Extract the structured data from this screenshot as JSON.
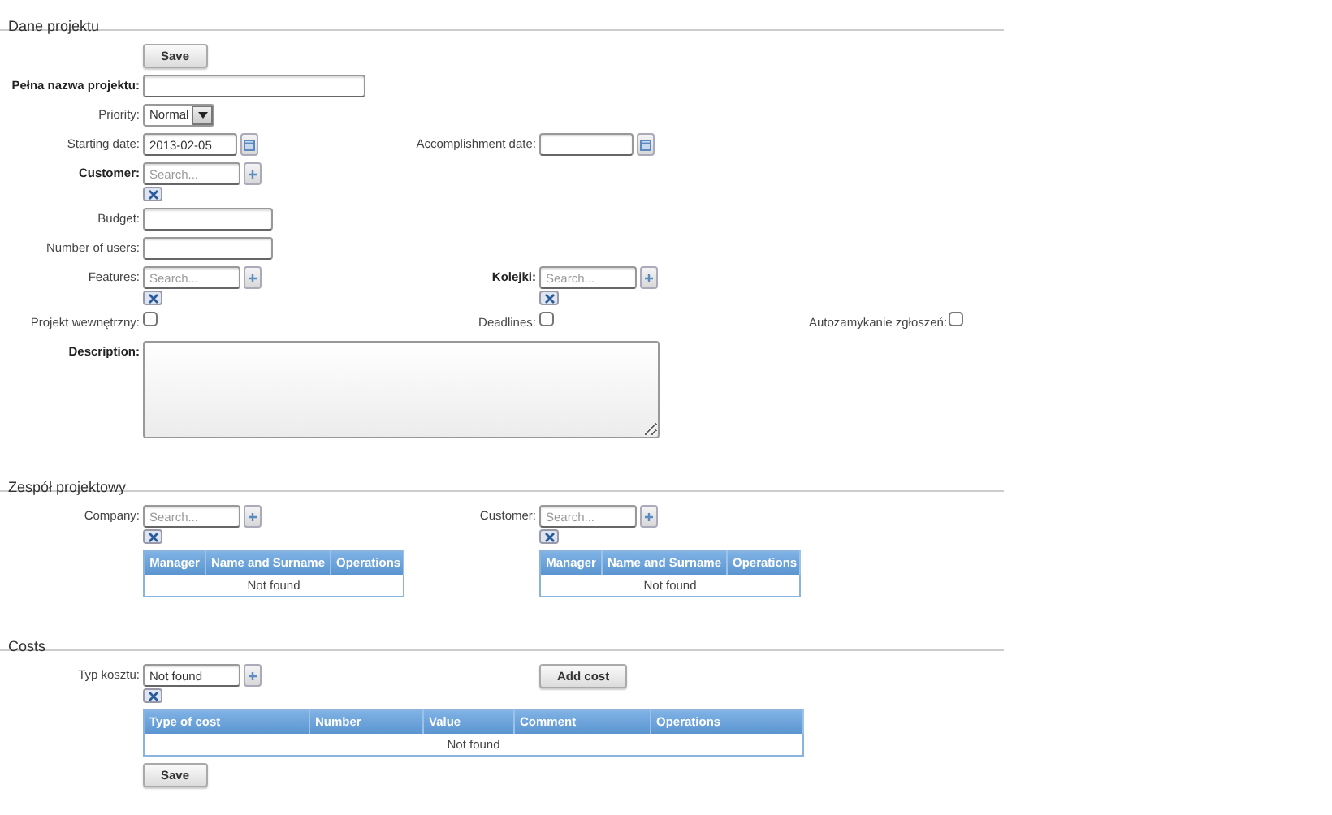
{
  "sections": [
    {
      "title": "Dane projektu",
      "rows": [
        {
          "left": {
            "kind": "button",
            "label": "Save"
          }
        },
        {
          "left": {
            "kind": "wide-text",
            "label": "Pełna nazwa projektu:",
            "bold": true
          }
        },
        {
          "left": {
            "kind": "select",
            "label": "Priority:",
            "bold": false,
            "value": "Normal"
          }
        },
        {
          "left": {
            "kind": "date",
            "label": "Starting date:",
            "bold": false,
            "value": "2013-02-05"
          },
          "middle": {
            "kind": "date",
            "label": "Accomplishment date:",
            "bold": false
          }
        },
        {
          "left": {
            "kind": "search",
            "label": "Customer:",
            "bold": true,
            "placeholder": "Search..."
          }
        },
        {
          "left": {
            "kind": "text",
            "label": "Budget:",
            "bold": false
          }
        },
        {
          "left": {
            "kind": "text",
            "label": "Number of users:",
            "bold": false
          }
        },
        {
          "left": {
            "kind": "search",
            "label": "Features:",
            "bold": false,
            "placeholder": "Search..."
          },
          "middle": {
            "kind": "search",
            "label": "Kolejki:",
            "bold": true,
            "placeholder": "Search..."
          }
        },
        {
          "left": {
            "kind": "checkbox",
            "label": "Projekt wewnętrzny:",
            "bold": false,
            "checked": false
          },
          "middle": {
            "kind": "checkbox",
            "label": "Deadlines:",
            "bold": false,
            "checked": false
          },
          "right": {
            "kind": "checkbox",
            "label": "Autozamykanie zgłoszeń:",
            "bold": false,
            "checked": false
          }
        },
        {
          "left": {
            "kind": "textarea",
            "label": "Description:",
            "bold": true
          }
        }
      ]
    },
    {
      "title": "Zespół projektowy",
      "rows": [
        {
          "left": {
            "kind": "search",
            "label": "Company:",
            "bold": false,
            "placeholder": "Search..."
          },
          "middle": {
            "kind": "search",
            "label": "Customer:",
            "bold": false,
            "placeholder": "Search..."
          }
        },
        {
          "left": {
            "kind": "table",
            "columns": [
              "Manager",
              "Name and Surname",
              "Operations"
            ],
            "empty_text": "Not found"
          },
          "middle": {
            "kind": "table",
            "columns": [
              "Manager",
              "Name and Surname",
              "Operations"
            ],
            "empty_text": "Not found"
          }
        }
      ]
    },
    {
      "title": "Costs",
      "rows": [
        {
          "left": {
            "kind": "search",
            "label": "Typ kosztu:",
            "bold": false,
            "value": "Not found"
          },
          "middle": {
            "kind": "button",
            "label": "Add cost"
          }
        },
        {
          "left": {
            "kind": "wide-table",
            "columns": [
              "Type of cost",
              "Number",
              "Value",
              "Comment",
              "Operations"
            ],
            "empty_text": "Not found"
          }
        },
        {
          "left": {
            "kind": "button",
            "label": "Save"
          }
        }
      ]
    }
  ]
}
